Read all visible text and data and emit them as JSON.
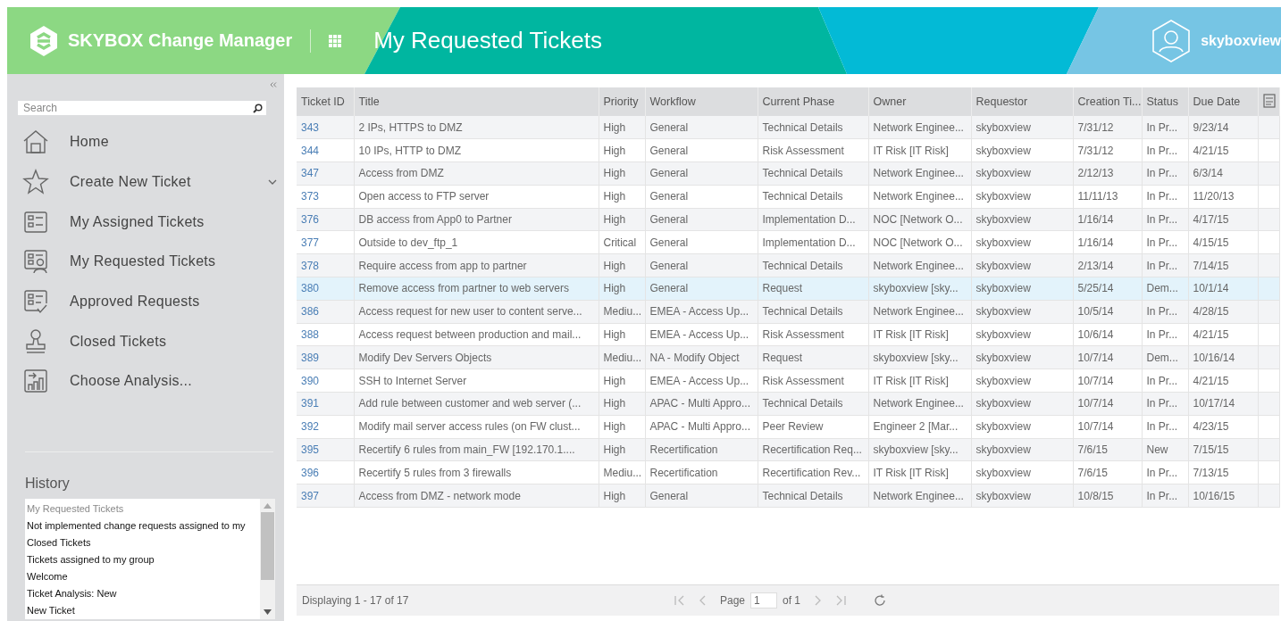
{
  "header": {
    "product": "SKYBOX Change Manager",
    "title": "My Requested Tickets",
    "user": "skyboxview"
  },
  "sidebar": {
    "search": {
      "placeholder": "Search"
    },
    "items": [
      {
        "label": "Home",
        "kind": "link"
      },
      {
        "label": "Create New Ticket",
        "kind": "submenu"
      },
      {
        "label": "My Assigned Tickets",
        "kind": "link"
      },
      {
        "label": "My Requested Tickets",
        "kind": "link"
      },
      {
        "label": "Approved Requests",
        "kind": "link"
      },
      {
        "label": "Closed Tickets",
        "kind": "link"
      },
      {
        "label": "Choose Analysis...",
        "kind": "link"
      }
    ],
    "history": {
      "title": "History",
      "items": [
        {
          "label": "My Requested Tickets",
          "selected": true
        },
        {
          "label": "Not implemented change requests assigned to my",
          "selected": false
        },
        {
          "label": "Closed Tickets",
          "selected": false
        },
        {
          "label": "Tickets assigned to my group",
          "selected": false
        },
        {
          "label": "Welcome",
          "selected": false
        },
        {
          "label": "Ticket Analysis: New",
          "selected": false
        },
        {
          "label": "New Ticket",
          "selected": false
        }
      ]
    }
  },
  "table": {
    "columns": [
      "Ticket ID",
      "Title",
      "Priority",
      "Workflow",
      "Current Phase",
      "Owner",
      "Requestor",
      "Creation Ti...",
      "Status",
      "Due Date"
    ],
    "rows": [
      {
        "selected": false,
        "cells": [
          "343",
          "2 IPs, HTTPS to DMZ",
          "High",
          "General",
          "Technical Details",
          "Network Enginee...",
          "skyboxview",
          "7/31/12",
          "In Pr...",
          "9/23/14"
        ]
      },
      {
        "selected": false,
        "cells": [
          "344",
          "10 IPs, HTTP to DMZ",
          "High",
          "General",
          "Risk Assessment",
          "IT Risk [IT Risk]",
          "skyboxview",
          "7/31/12",
          "In Pr...",
          "4/21/15"
        ]
      },
      {
        "selected": false,
        "cells": [
          "347",
          "Access from DMZ",
          "High",
          "General",
          "Technical Details",
          "Network Enginee...",
          "skyboxview",
          "2/12/13",
          "In Pr...",
          "6/3/14"
        ]
      },
      {
        "selected": false,
        "cells": [
          "373",
          "Open access to FTP server",
          "High",
          "General",
          "Technical Details",
          "Network Enginee...",
          "skyboxview",
          "11/11/13",
          "In Pr...",
          "11/20/13"
        ]
      },
      {
        "selected": false,
        "cells": [
          "376",
          "DB access from App0 to Partner",
          "High",
          "General",
          "Implementation D...",
          "NOC [Network O...",
          "skyboxview",
          "1/16/14",
          "In Pr...",
          "4/17/15"
        ]
      },
      {
        "selected": false,
        "cells": [
          "377",
          "Outside to dev_ftp_1",
          "Critical",
          "General",
          "Implementation D...",
          "NOC [Network O...",
          "skyboxview",
          "1/16/14",
          "In Pr...",
          "4/15/15"
        ]
      },
      {
        "selected": false,
        "cells": [
          "378",
          "Require access from app to partner",
          "High",
          "General",
          "Technical Details",
          "Network Enginee...",
          "skyboxview",
          "2/13/14",
          "In Pr...",
          "7/14/15"
        ]
      },
      {
        "selected": true,
        "cells": [
          "380",
          "Remove access from partner to web servers",
          "High",
          "General",
          "Request",
          "skyboxview [sky...",
          "skyboxview",
          "5/25/14",
          "Dem...",
          "10/1/14"
        ]
      },
      {
        "selected": false,
        "cells": [
          "386",
          "Access request for new user to content serve...",
          "Mediu...",
          "EMEA - Access Up...",
          "Technical Details",
          "Network Enginee...",
          "skyboxview",
          "10/5/14",
          "In Pr...",
          "4/28/15"
        ]
      },
      {
        "selected": false,
        "cells": [
          "388",
          "Access request between production and mail...",
          "High",
          "EMEA - Access Up...",
          "Risk Assessment",
          "IT Risk [IT Risk]",
          "skyboxview",
          "10/6/14",
          "In Pr...",
          "4/21/15"
        ]
      },
      {
        "selected": false,
        "cells": [
          "389",
          "Modify Dev Servers Objects",
          "Mediu...",
          "NA - Modify Object",
          "Request",
          "skyboxview [sky...",
          "skyboxview",
          "10/7/14",
          "Dem...",
          "10/16/14"
        ]
      },
      {
        "selected": false,
        "cells": [
          "390",
          "SSH to Internet Server",
          "High",
          "EMEA - Access Up...",
          "Risk Assessment",
          "IT Risk [IT Risk]",
          "skyboxview",
          "10/7/14",
          "In Pr...",
          "4/21/15"
        ]
      },
      {
        "selected": false,
        "cells": [
          "391",
          "Add rule between customer and web server (...",
          "High",
          "APAC - Multi Appro...",
          "Technical Details",
          "Network Enginee...",
          "skyboxview",
          "10/7/14",
          "In Pr...",
          "10/17/14"
        ]
      },
      {
        "selected": false,
        "cells": [
          "392",
          "Modify mail server access rules (on FW clust...",
          "High",
          "APAC - Multi Appro...",
          "Peer Review",
          "Engineer 2 [Mar...",
          "skyboxview",
          "10/7/14",
          "In Pr...",
          "4/23/15"
        ]
      },
      {
        "selected": false,
        "cells": [
          "395",
          "Recertify 6 rules from main_FW [192.170.1....",
          "High",
          "Recertification",
          "Recertification Req...",
          "skyboxview [sky...",
          "skyboxview",
          "7/6/15",
          "New",
          "7/15/15"
        ]
      },
      {
        "selected": false,
        "cells": [
          "396",
          "Recertify 5 rules from 3 firewalls",
          "Mediu...",
          "Recertification",
          "Recertification Rev...",
          "IT Risk [IT Risk]",
          "skyboxview",
          "7/6/15",
          "In Pr...",
          "7/13/15"
        ]
      },
      {
        "selected": false,
        "cells": [
          "397",
          "Access from DMZ - network mode",
          "High",
          "General",
          "Technical Details",
          "Network Enginee...",
          "skyboxview",
          "10/8/15",
          "In Pr...",
          "10/16/15"
        ]
      }
    ]
  },
  "pager": {
    "summary": "Displaying 1 - 17 of 17",
    "page_label": "Page",
    "page": "1",
    "of": "of 1"
  }
}
